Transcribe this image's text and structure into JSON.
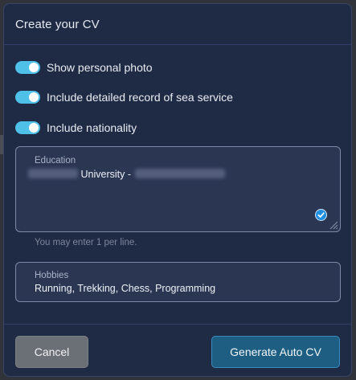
{
  "dialog": {
    "title": "Create your CV"
  },
  "toggles": [
    {
      "label": "Show personal photo",
      "on": true
    },
    {
      "label": "Include detailed record of sea service",
      "on": true
    },
    {
      "label": "Include nationality",
      "on": true
    }
  ],
  "education": {
    "label": "Education",
    "value_visible": "University -",
    "helper": "You may enter 1 per line."
  },
  "hobbies": {
    "label": "Hobbies",
    "value": "Running, Trekking, Chess, Programming"
  },
  "footer": {
    "cancel_label": "Cancel",
    "generate_label": "Generate Auto CV"
  },
  "colors": {
    "toggle_on": "#4fc1e9",
    "dialog_bg": "#1f2a45",
    "primary_button": "#1d5e82",
    "secondary_button": "#6b6f76"
  },
  "icons": {
    "education_badge": "check-circle-icon",
    "education_resize": "resize-grip-icon"
  }
}
